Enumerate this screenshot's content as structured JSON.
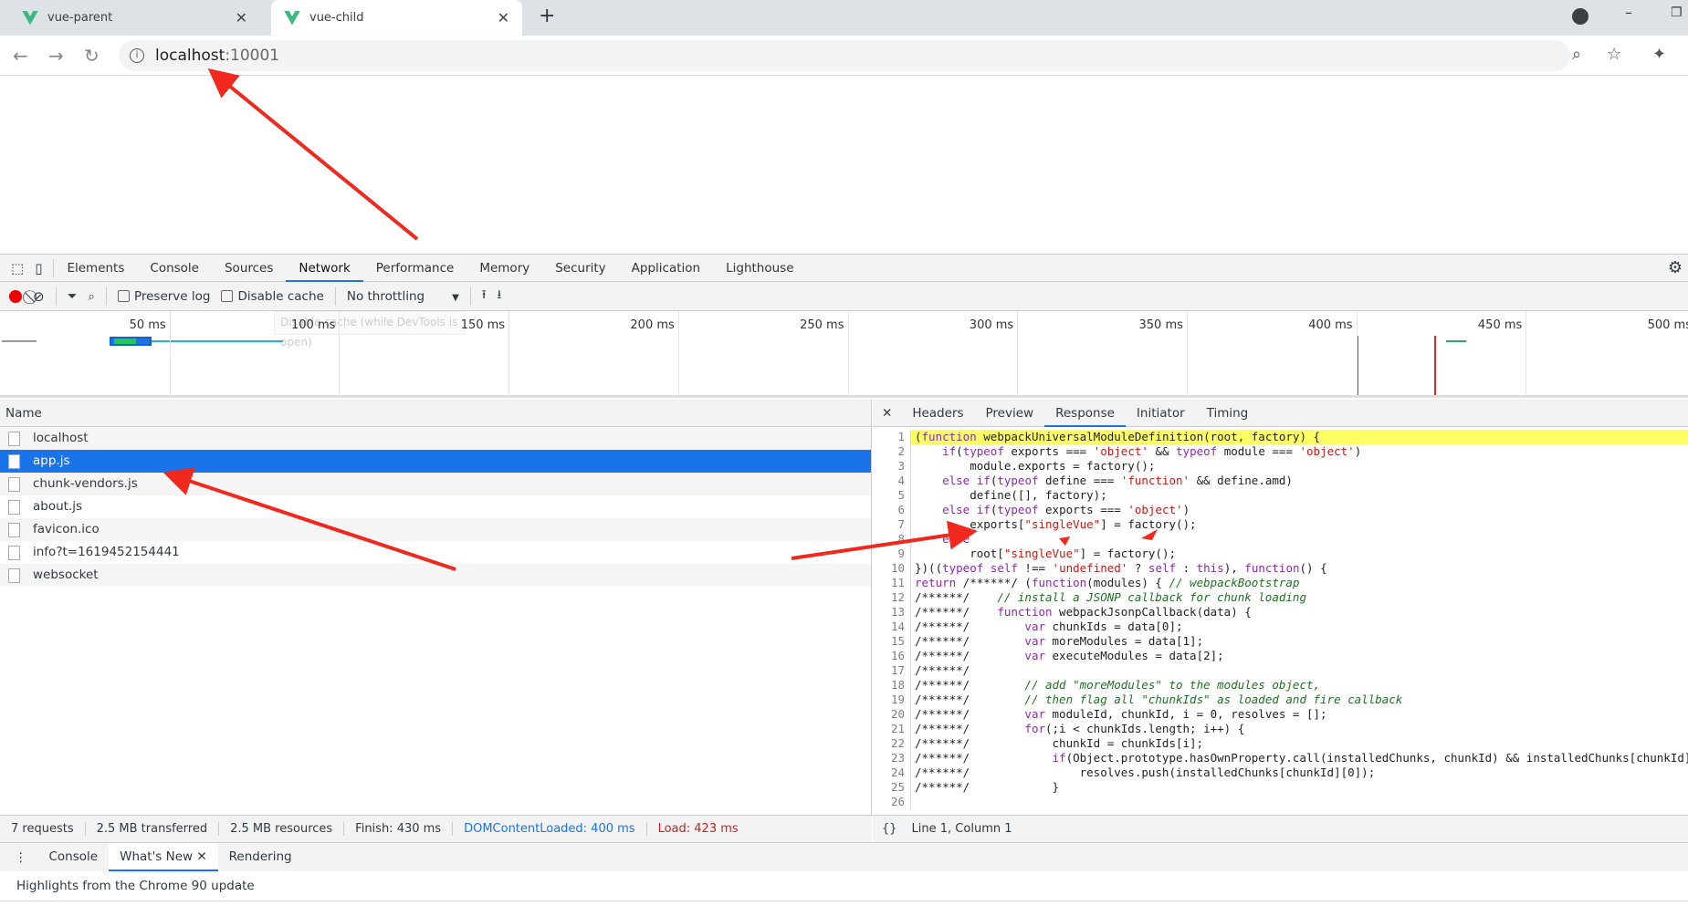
{
  "browser": {
    "tabs": [
      {
        "title": "vue-parent"
      },
      {
        "title": "vue-child",
        "active": true
      }
    ],
    "url_host": "localhost",
    "url_port": ":10001"
  },
  "devtools": {
    "tabs": [
      "Elements",
      "Console",
      "Sources",
      "Network",
      "Performance",
      "Memory",
      "Security",
      "Application",
      "Lighthouse"
    ],
    "selected_tab": "Network"
  },
  "toolbar": {
    "preserve_log": "Preserve log",
    "disable_cache": "Disable cache",
    "throttling": "No throttling",
    "tooltip": "Disable cache (while DevTools is open)"
  },
  "timeline": {
    "ticks": [
      "50 ms",
      "100 ms",
      "150 ms",
      "200 ms",
      "250 ms",
      "300 ms",
      "350 ms",
      "400 ms",
      "450 ms",
      "500 ms"
    ],
    "dom_content_loaded_ms": 400,
    "load_ms": 423
  },
  "requests": {
    "header": "Name",
    "items": [
      "localhost",
      "app.js",
      "chunk-vendors.js",
      "about.js",
      "favicon.ico",
      "info?t=1619452154441",
      "websocket"
    ],
    "selected": "app.js"
  },
  "status": {
    "requests": "7 requests",
    "transferred": "2.5 MB transferred",
    "resources": "2.5 MB resources",
    "finish": "Finish: 430 ms",
    "dcl": "DOMContentLoaded: 400 ms",
    "load": "Load: 423 ms"
  },
  "detail": {
    "tabs": [
      "Headers",
      "Preview",
      "Response",
      "Initiator",
      "Timing"
    ],
    "selected": "Response",
    "cursor": "Line 1, Column 1",
    "code": [
      "(function webpackUniversalModuleDefinition(root, factory) {",
      "    if(typeof exports === 'object' && typeof module === 'object')",
      "        module.exports = factory();",
      "    else if(typeof define === 'function' && define.amd)",
      "        define([], factory);",
      "    else if(typeof exports === 'object')",
      "        exports[\"singleVue\"] = factory();",
      "    else",
      "        root[\"singleVue\"] = factory();",
      "})((typeof self !== 'undefined' ? self : this), function() {",
      "return /******/ (function(modules) { // webpackBootstrap",
      "/******/    // install a JSONP callback for chunk loading",
      "/******/    function webpackJsonpCallback(data) {",
      "/******/        var chunkIds = data[0];",
      "/******/        var moreModules = data[1];",
      "/******/        var executeModules = data[2];",
      "/******/",
      "/******/        // add \"moreModules\" to the modules object,",
      "/******/        // then flag all \"chunkIds\" as loaded and fire callback",
      "/******/        var moduleId, chunkId, i = 0, resolves = [];",
      "/******/        for(;i < chunkIds.length; i++) {",
      "/******/            chunkId = chunkIds[i];",
      "/******/            if(Object.prototype.hasOwnProperty.call(installedChunks, chunkId) && installedChunks[chunkId]) {",
      "/******/                resolves.push(installedChunks[chunkId][0]);",
      "/******/            }",
      ""
    ]
  },
  "drawer": {
    "tabs": [
      "Console",
      "What's New",
      "Rendering"
    ],
    "selected": "What's New",
    "content": "Highlights from the Chrome 90 update"
  },
  "colors": {
    "accent": "#1a73e8",
    "annotation_arrow": "#f0281e",
    "dcl_line": "#1a73e8",
    "load_line": "#d93025"
  }
}
